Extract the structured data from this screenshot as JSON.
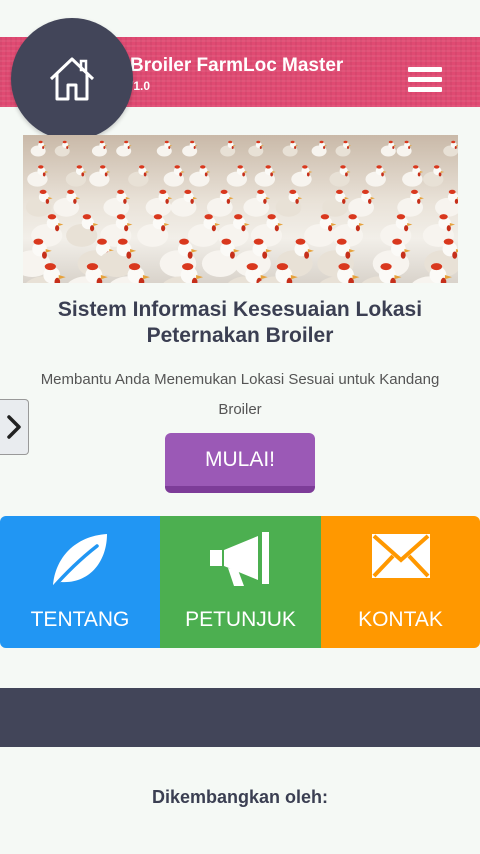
{
  "header": {
    "title": "Broiler FarmLoc Master",
    "version": "/1.0",
    "menu_icon": "hamburger-menu-icon",
    "home_icon": "home-icon",
    "accent_color": "#e04a72"
  },
  "banner": {
    "image_subject": "broiler chickens"
  },
  "main": {
    "headline": "Sistem Informasi Kesesuaian Lokasi Peternakan Broiler",
    "subtext": "Membantu Anda Menemukan Lokasi Sesuai untuk Kandang Broiler",
    "start_label": "MULAI!",
    "start_color": "#9b59b6"
  },
  "tiles": [
    {
      "label": "TENTANG",
      "icon": "leaf-icon",
      "color": "#2196f3"
    },
    {
      "label": "PETUNJUK",
      "icon": "megaphone-icon",
      "color": "#4caf50"
    },
    {
      "label": "KONTAK",
      "icon": "envelope-icon",
      "color": "#ff9800"
    }
  ],
  "footer": {
    "developer_label": "Dikembangkan oleh:",
    "bar_color": "#424559"
  }
}
